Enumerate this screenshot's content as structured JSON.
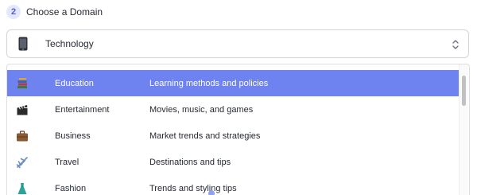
{
  "step": {
    "number": "2",
    "title": "Choose a Domain"
  },
  "select": {
    "icon": "mobile-phone-icon",
    "value": "Technology"
  },
  "options": [
    {
      "label": "Education",
      "description": "Learning methods and policies",
      "icon": "books-icon",
      "selected": true
    },
    {
      "label": "Entertainment",
      "description": "Movies, music, and games",
      "icon": "clapper-board-icon",
      "selected": false
    },
    {
      "label": "Business",
      "description": "Market trends and strategies",
      "icon": "briefcase-icon",
      "selected": false
    },
    {
      "label": "Travel",
      "description": "Destinations and tips",
      "icon": "airplane-icon",
      "selected": false
    },
    {
      "label": "Fashion",
      "description": "Trends and styling tips",
      "icon": "dress-icon",
      "selected": false
    }
  ],
  "colors": {
    "accent": "#6f83f0",
    "badge_bg": "#e4e8fb",
    "badge_text": "#4e5bd1"
  }
}
